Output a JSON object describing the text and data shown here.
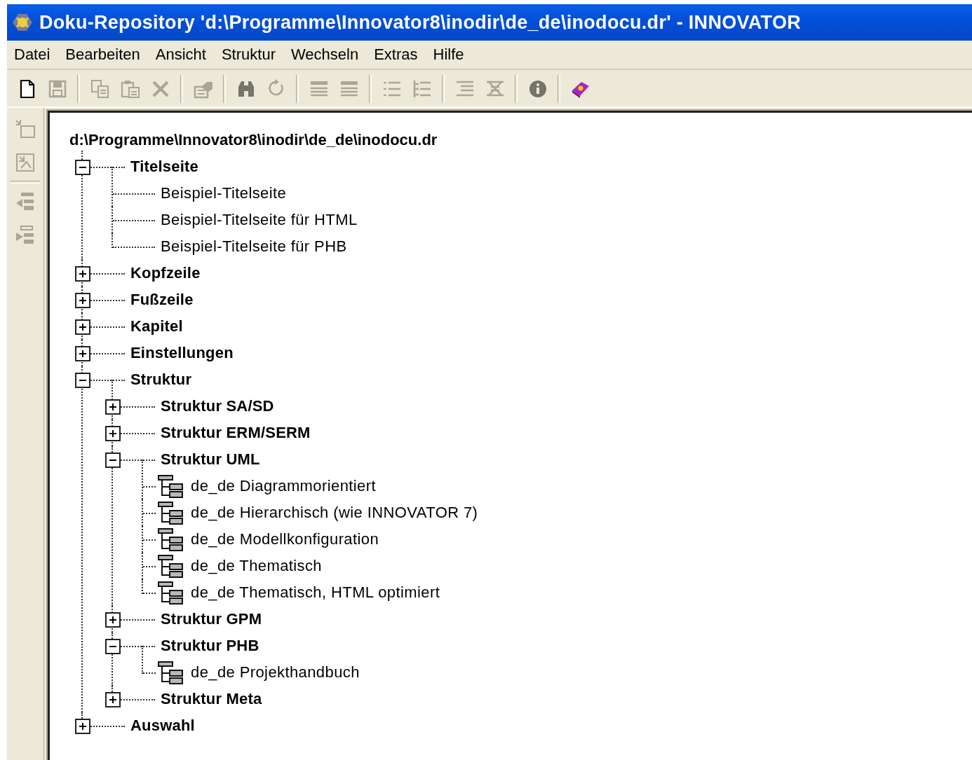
{
  "window": {
    "title": "Doku-Repository 'd:\\Programme\\Innovator8\\inodir\\de_de\\inodocu.dr' - INNOVATOR"
  },
  "menu": [
    "Datei",
    "Bearbeiten",
    "Ansicht",
    "Struktur",
    "Wechseln",
    "Extras",
    "Hilfe"
  ],
  "toolbar": {
    "groups": [
      [
        {
          "disabled": false
        },
        {
          "disabled": true
        }
      ],
      [
        {
          "disabled": true
        },
        {
          "disabled": true
        },
        {
          "disabled": true
        }
      ],
      [
        {
          "disabled": true
        }
      ],
      [
        {
          "disabled": true
        },
        {
          "disabled": true
        }
      ],
      [
        {
          "disabled": true
        },
        {
          "disabled": true
        }
      ],
      [
        {
          "disabled": true
        },
        {
          "disabled": true
        }
      ],
      [
        {
          "disabled": true
        },
        {
          "disabled": true
        }
      ],
      [
        {
          "disabled": true
        }
      ],
      [
        {
          "disabled": false
        }
      ]
    ]
  },
  "side_toolbar": {
    "groups": [
      [
        {
          "disabled": true
        },
        {
          "disabled": true
        }
      ],
      [
        {
          "disabled": true
        },
        {
          "disabled": true
        }
      ]
    ]
  },
  "tree": {
    "root": "d:\\Programme\\Innovator8\\inodir\\de_de\\inodocu.dr",
    "children": [
      {
        "label": "Titelseite",
        "kind": "group",
        "expanded": true,
        "children": [
          {
            "label": "Beispiel-Titelseite",
            "kind": "entry"
          },
          {
            "label": "Beispiel-Titelseite für HTML",
            "kind": "entry"
          },
          {
            "label": "Beispiel-Titelseite für PHB",
            "kind": "entry"
          }
        ]
      },
      {
        "label": "Kopfzeile",
        "kind": "group",
        "expanded": false
      },
      {
        "label": "Fußzeile",
        "kind": "group",
        "expanded": false
      },
      {
        "label": "Kapitel",
        "kind": "group",
        "expanded": false
      },
      {
        "label": "Einstellungen",
        "kind": "group",
        "expanded": false
      },
      {
        "label": "Struktur",
        "kind": "group",
        "expanded": true,
        "children": [
          {
            "label": "Struktur SA/SD",
            "kind": "group",
            "expanded": false
          },
          {
            "label": "Struktur ERM/SERM",
            "kind": "group",
            "expanded": false
          },
          {
            "label": "Struktur UML",
            "kind": "group",
            "expanded": true,
            "children": [
              {
                "label": "de_de Diagrammorientiert",
                "kind": "structure"
              },
              {
                "label": "de_de Hierarchisch (wie INNOVATOR 7)",
                "kind": "structure"
              },
              {
                "label": "de_de Modellkonfiguration",
                "kind": "structure"
              },
              {
                "label": "de_de Thematisch",
                "kind": "structure"
              },
              {
                "label": "de_de Thematisch, HTML optimiert",
                "kind": "structure"
              }
            ]
          },
          {
            "label": "Struktur GPM",
            "kind": "group",
            "expanded": false
          },
          {
            "label": "Struktur PHB",
            "kind": "group",
            "expanded": true,
            "children": [
              {
                "label": "de_de Projekthandbuch",
                "kind": "structure"
              }
            ]
          },
          {
            "label": "Struktur Meta",
            "kind": "group",
            "expanded": false
          }
        ]
      },
      {
        "label": "Auswahl",
        "kind": "group",
        "expanded": false
      }
    ]
  }
}
